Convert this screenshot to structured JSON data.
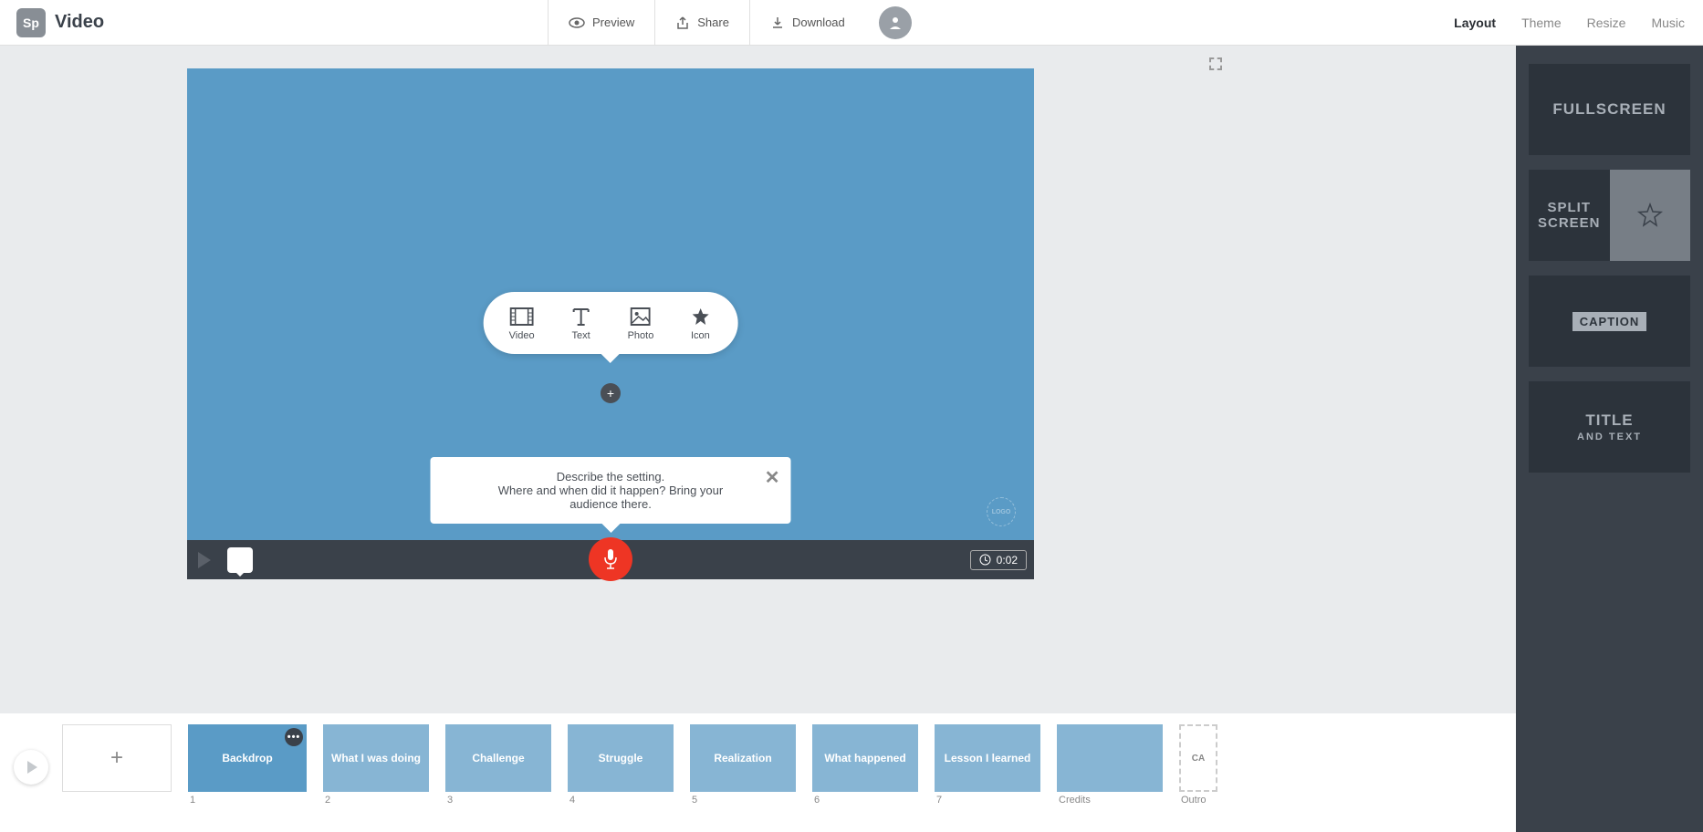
{
  "header": {
    "logo_badge": "Sp",
    "app_name": "Video",
    "preview": "Preview",
    "share": "Share",
    "download": "Download",
    "tabs": [
      "Layout",
      "Theme",
      "Resize",
      "Music"
    ],
    "active_tab": "Layout"
  },
  "canvas": {
    "add_menu": {
      "video": "Video",
      "text": "Text",
      "photo": "Photo",
      "icon": "Icon"
    },
    "hint_line1": "Describe the setting.",
    "hint_line2": "Where and when did it happen? Bring your audience there.",
    "logo_placeholder": "LOGO",
    "duration": "0:02"
  },
  "timeline": {
    "slides": [
      {
        "label": "Backdrop",
        "num": "1",
        "active": true
      },
      {
        "label": "What I was doing",
        "num": "2"
      },
      {
        "label": "Challenge",
        "num": "3"
      },
      {
        "label": "Struggle",
        "num": "4"
      },
      {
        "label": "Realization",
        "num": "5"
      },
      {
        "label": "What happened",
        "num": "6"
      },
      {
        "label": "Lesson I learned",
        "num": "7"
      },
      {
        "label": "",
        "num": "Credits"
      }
    ],
    "outro": "Outro",
    "outro_badge": "CA"
  },
  "layouts": {
    "fullscreen": "FULLSCREEN",
    "split1": "SPLIT",
    "split2": "SCREEN",
    "caption": "CAPTION",
    "title": "TITLE",
    "title_sub": "AND TEXT"
  }
}
